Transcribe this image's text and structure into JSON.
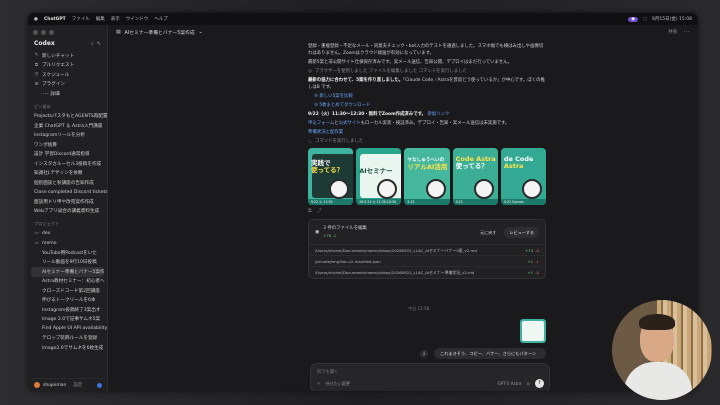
{
  "menubar": {
    "app": "ChatGPT",
    "menus": [
      "ファイル",
      "編集",
      "表示",
      "ウインドウ",
      "ヘルプ"
    ],
    "status_time": "8月15日(金) 15:08"
  },
  "sidebar": {
    "title": "Codex",
    "nav": [
      {
        "icon": "compose-icon",
        "label": "新しいチャット"
      },
      {
        "icon": "puzzle-icon",
        "label": "プルリクエスト"
      },
      {
        "icon": "clock-icon",
        "label": "スケジュール"
      },
      {
        "icon": "plugin-icon",
        "label": "プラグイン"
      },
      {
        "icon": "more-icon",
        "label": "･･･ 詳細"
      }
    ],
    "section_chats": "ピン留め",
    "chats": [
      "ProjectsパスタもとAGENTS再配置",
      "企業 ChatGPT ＆ Astra入門講座",
      "Instagramリールを分析",
      "ワンポ換算",
      "設計 学習Discord通常指導",
      "インスタカルーセル3投稿を作成",
      "知識社Lデザインを依頼",
      "個別面談と秋講座の告知作成",
      "Close completed Discord tickets",
      "面談用ドリ申や改宛案作作成",
      "Webアプリ試合の講義資料生成"
    ],
    "section_projects": "プロジェクト",
    "projects": [
      "dev",
      "memo"
    ],
    "project_items": [
      "YouTube用Podcastをいた",
      "リール動画を9行10日投稿",
      "AIセミナー準備とバナー5案作成",
      "Astra教材セミナー：初心者へ",
      "クローズドコード第2回講座",
      "伸びるトークリールを6本",
      "Instagram投稿終了3案出す",
      "Image 2.0で記事サムネ5案",
      "Find Apple UI API availability",
      "テロップ装飾ルールを登録",
      "Image2.0でサムネを6枚生成"
    ],
    "user": "shujeiman",
    "footer_action": "設定"
  },
  "main": {
    "thread_title": "AIセミナー準備とバナー5案作成",
    "top_actions": [
      "共有",
      "･･･"
    ],
    "paragraphs": [
      "登録・重複登録・不足なメール・同意夫チェック・bot入力のテストを通過しました。スマホ幅でも横はみ出しや画像切れはありません。Zoomはクラウド録画が有効になっています。",
      "最新5案と非公開サイト仕様保存済みです。実メール送信、告知公開、デプロイはまだ行っていません。"
    ],
    "tool_browser": "ブラウザーを使用しました ファイルを編集しました コマンドを実行しました",
    "summary_bold": "最新の協力に合わせて、5案を作り直しました。",
    "summary_rest": "「Claude Code／Astraを普段どう使っているか」が中心です。ぼくの推しはB です。",
    "bullets": [
      "⑨ 新しい5案を比較",
      "⑩ 5枚まとめてダウンロード"
    ],
    "event_line_bold": "9/22（火）11:30〜12:30・無料でZoom作成済みです。",
    "event_line_link": "参加リンク",
    "form_line_pre": "申込フォーム",
    "form_line_mid": "と",
    "form_line_link": "公式サイト",
    "form_line_post": "もローカル実装・検証済み。デプロイ・告知・実メール送信は未実施です。",
    "preview_link": "準備状況と配作業",
    "tool_cmd": "コマンドを実行しました",
    "thumbnails": [
      {
        "line1": "実践で",
        "line2": "使ってる？",
        "date": "9.22 火 11:30"
      },
      {
        "line1": "AIセミナー",
        "line2": "",
        "date": "26.9.22 火 11:30-12:30"
      },
      {
        "line1": "ヤなしゅうへいの",
        "line2": "リアルAI活用",
        "date": "9.22"
      },
      {
        "line1": "Code Astra",
        "line2": "使ってる？",
        "date": "9.22"
      },
      {
        "line1": "de Code",
        "line2": "Astra",
        "date": "9.22 Canvas"
      }
    ],
    "files_header": "3 件のファイルを編集",
    "files_count": "+76 -1",
    "files_undo": "元に戻す",
    "files_review": "レビューする",
    "files": [
      {
        "path": "/Users/shuhei/Documents/memo/inbox/20260922_LLAC_AIセミナーバナー5案_v2.md",
        "plus": "+74",
        "minus": "-0"
      },
      {
        "path": "/private/tmp/llac-v2-manifest.json",
        "plus": "+1",
        "minus": "-1"
      },
      {
        "path": "/Users/shuhei/Documents/memo/inbox/20260922_LLAC_AIセミナー準備状況_v2.md",
        "plus": "+1",
        "minus": "-0"
      }
    ],
    "time_separator": "今日 12:58",
    "user_message": "これまきそう、コピー、バナー、さらにもパターン"
  },
  "composer": {
    "placeholder": "何でも聞く",
    "add": "+",
    "mode": "任せたい変更",
    "model": "GPT-5 Astra",
    "mic": "◎"
  },
  "colors": {
    "accent": "#3db3a0",
    "link": "#6aa7ff",
    "added": "#6fcf73",
    "removed": "#e06c6c"
  }
}
